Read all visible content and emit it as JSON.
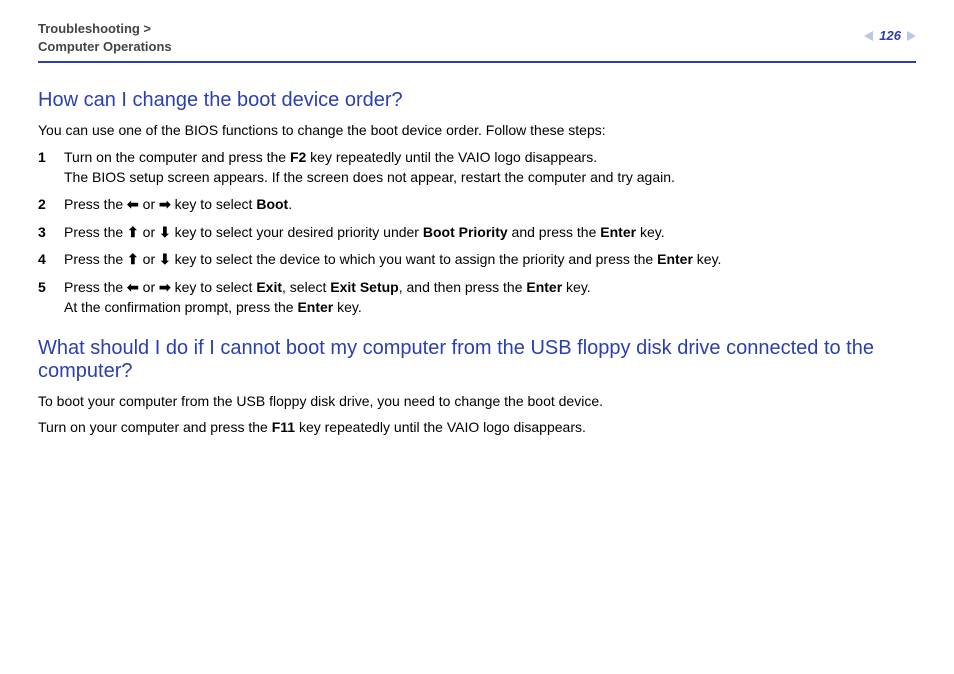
{
  "header": {
    "breadcrumb_line1": "Troubleshooting >",
    "breadcrumb_line2": "Computer Operations",
    "page_number": "126"
  },
  "section1": {
    "heading": "How can I change the boot device order?",
    "intro": "You can use one of the BIOS functions to change the boot device order. Follow these steps:",
    "steps": [
      {
        "n": "1",
        "pre": "Turn on the computer and press the ",
        "bold1": "F2",
        "mid1": " key repeatedly until the VAIO logo disappears.",
        "line2": "The BIOS setup screen appears. If the screen does not appear, restart the computer and try again."
      },
      {
        "n": "2",
        "pre": "Press the ",
        "arrow1": "⬅",
        "mid_or": " or ",
        "arrow2": "➡",
        "mid1": " key to select ",
        "bold1": "Boot",
        "post": "."
      },
      {
        "n": "3",
        "pre": "Press the ",
        "arrow1": "⬆",
        "mid_or": " or ",
        "arrow2": "⬇",
        "mid1": " key to select your desired priority under ",
        "bold1": "Boot Priority",
        "mid2": " and press the ",
        "bold2": "Enter",
        "post": " key."
      },
      {
        "n": "4",
        "pre": "Press the ",
        "arrow1": "⬆",
        "mid_or": " or ",
        "arrow2": "⬇",
        "mid1": " key to select the device to which you want to assign the priority and press the ",
        "bold1": "Enter",
        "post": " key."
      },
      {
        "n": "5",
        "pre": "Press the ",
        "arrow1": "⬅",
        "mid_or": " or ",
        "arrow2": "➡",
        "mid1": " key to select ",
        "bold1": "Exit",
        "mid2": ", select ",
        "bold2": "Exit Setup",
        "mid3": ", and then press the ",
        "bold3": "Enter",
        "post": " key.",
        "line2_pre": "At the confirmation prompt, press the ",
        "line2_bold": "Enter",
        "line2_post": " key."
      }
    ]
  },
  "section2": {
    "heading": "What should I do if I cannot boot my computer from the USB floppy disk drive connected to the computer?",
    "para1": "To boot your computer from the USB floppy disk drive, you need to change the boot device.",
    "para2_pre": "Turn on your computer and press the ",
    "para2_bold": "F11",
    "para2_post": " key repeatedly until the VAIO logo disappears."
  }
}
